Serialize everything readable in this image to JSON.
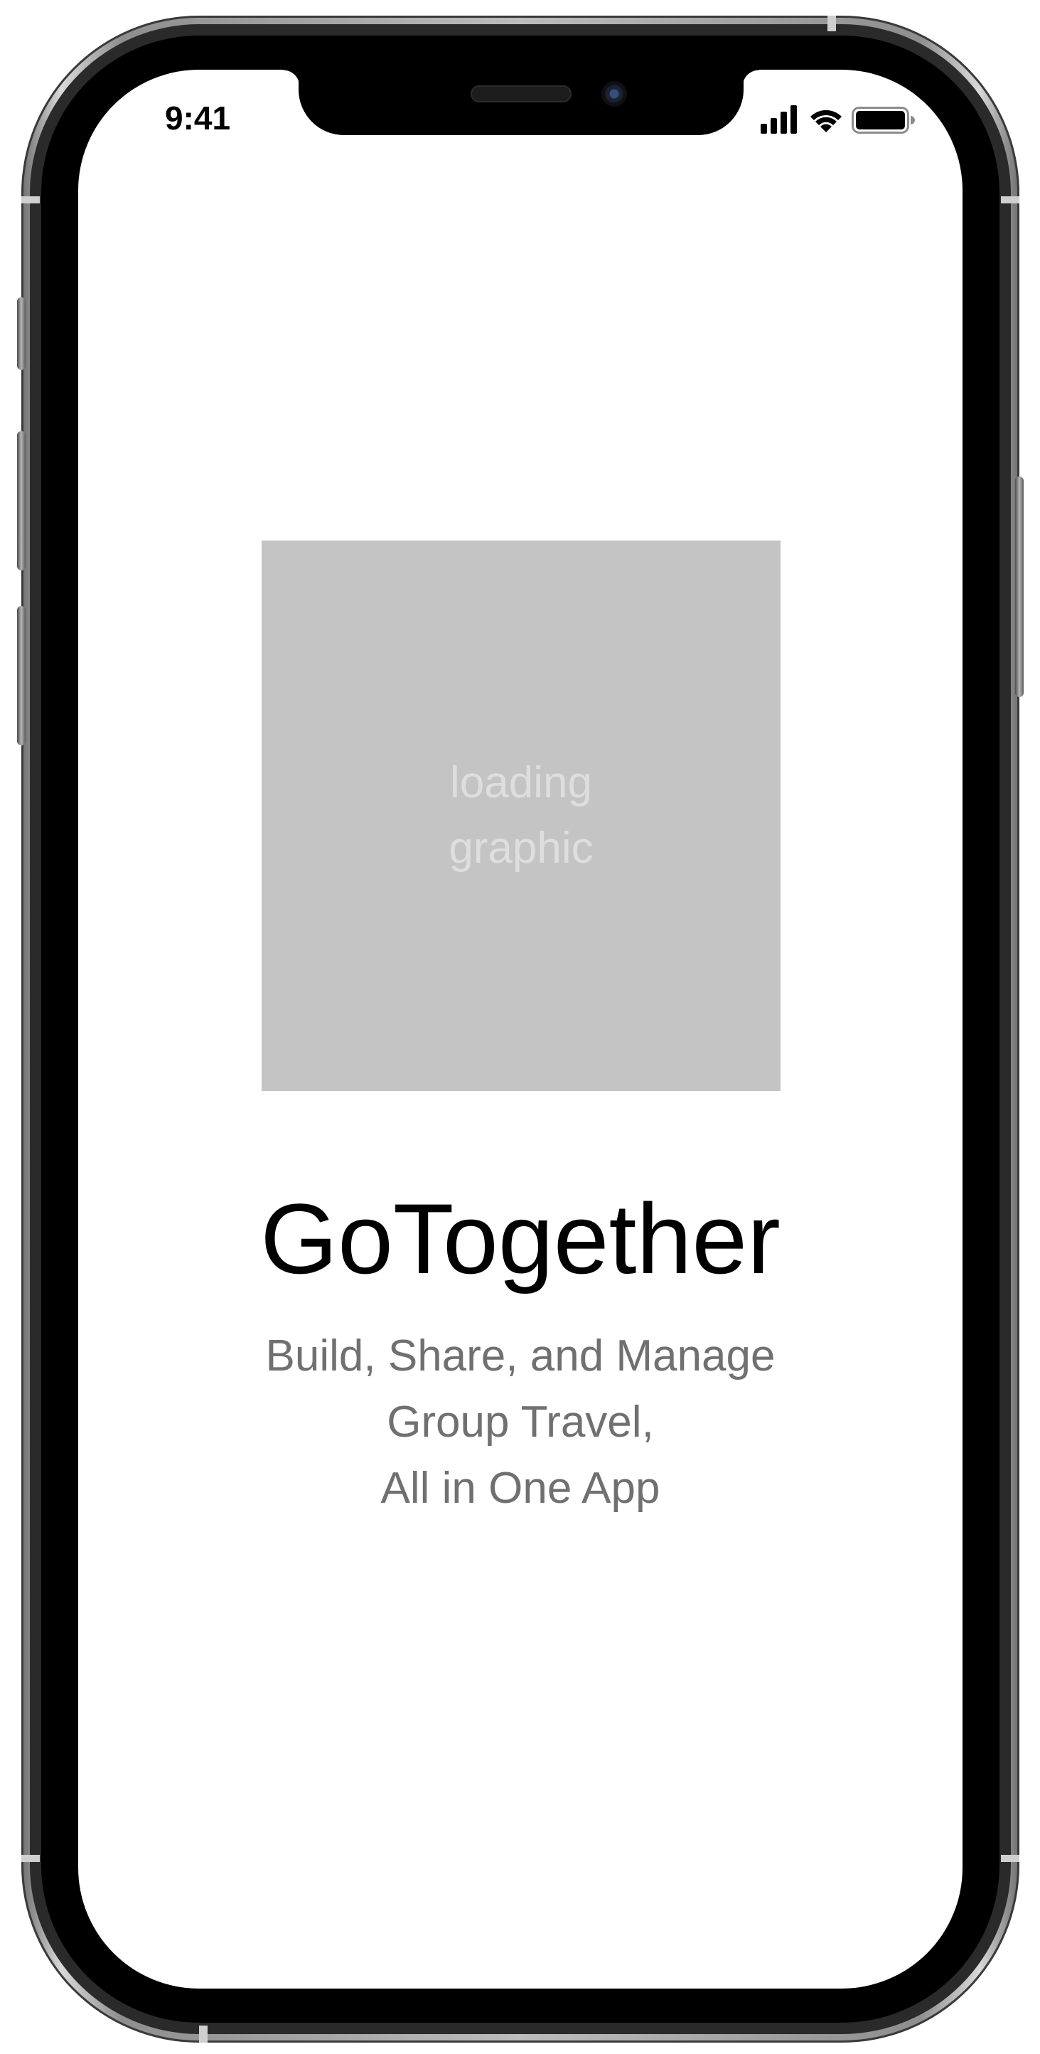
{
  "status_bar": {
    "time": "9:41",
    "icons": [
      "cellular-signal-icon",
      "wifi-icon",
      "battery-icon"
    ]
  },
  "splash": {
    "loading_graphic_label": "loading\ngraphic",
    "app_title": "GoTogether",
    "tagline_lines": [
      "Build, Share, and Manage",
      "Group Travel,",
      "All in One App"
    ]
  },
  "colors": {
    "placeholder_bg": "#c4c4c4",
    "placeholder_text": "#dedede",
    "title": "#000000",
    "tagline": "#707070",
    "screen_bg": "#ffffff"
  }
}
